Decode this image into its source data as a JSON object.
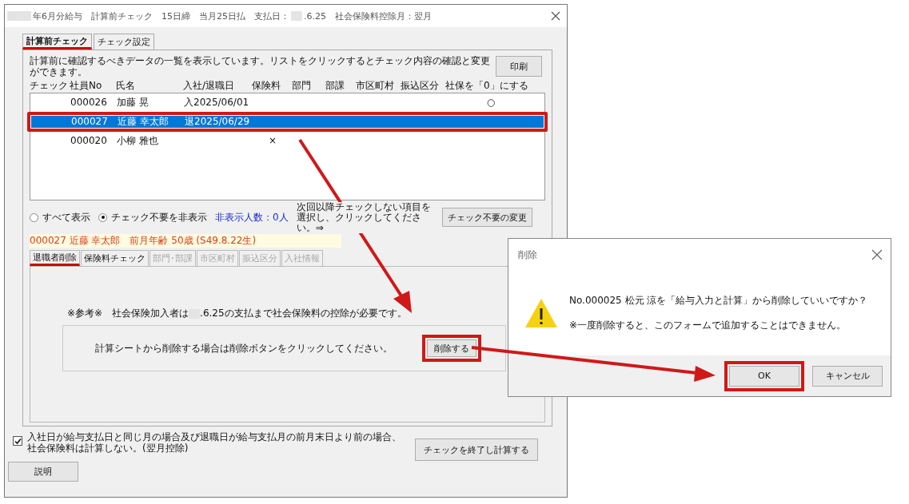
{
  "window": {
    "title_before": "年6月分給与　計算前チェック　15日締　当月25日払　支払日：",
    "title_after": ".6.25　社会保険料控除月：翌月"
  },
  "tabs": [
    {
      "label": "計算前チェック",
      "selected": true
    },
    {
      "label": "チェック設定",
      "selected": false
    }
  ],
  "instruction": "計算前に確認するべきデータの一覧を表示しています。リストをクリックするとチェック内容の確認と変更ができます。",
  "print_button": "印刷",
  "columns": [
    "チェック",
    "社員No",
    "氏名",
    "入社/退職日",
    "保険料",
    "部門",
    "部課",
    "市区町村",
    "振込区分",
    "社保を「0」にする"
  ],
  "rows": [
    {
      "no": "000026",
      "name": "加藤 晃",
      "date": "入2025/06/01",
      "zero": "○",
      "selected": false
    },
    {
      "no": "000027",
      "name": "近藤 幸太郎",
      "date": "退2025/06/29",
      "selected": true
    },
    {
      "no": "000020",
      "name": "小柳 雅也",
      "insurance": "×",
      "selected": false
    }
  ],
  "filter_options": [
    {
      "label": "すべて表示",
      "selected": false
    },
    {
      "label": "チェック不要を非表示",
      "selected": true
    }
  ],
  "hidden_count": "非表示人数：0人",
  "hint": "次回以降チェックしない項目を選択し、クリックしてください。⇒",
  "change_button": "チェック不要の変更",
  "employee_info": "000027 近藤 幸太郎　前月年齢 50歳 (S49.8.22生)",
  "sub_tabs": [
    {
      "label": "退職者削除",
      "selected": true,
      "disabled": false
    },
    {
      "label": "保険料チェック",
      "selected": false,
      "disabled": false
    },
    {
      "label": "部門･部課",
      "selected": false,
      "disabled": true
    },
    {
      "label": "市区町村",
      "selected": false,
      "disabled": true
    },
    {
      "label": "振込区分",
      "selected": false,
      "disabled": true
    },
    {
      "label": "入社情報",
      "selected": false,
      "disabled": true
    }
  ],
  "note_before": "※参考※　社会保険加入者は",
  "note_after": ".6.25の支払まで社会保険料の控除が必要です。",
  "delete_instruction": "計算シートから削除する場合は削除ボタンをクリックしてください。",
  "delete_button": "削除する",
  "exclude_option": {
    "lines": [
      "入社日が給与支払日と同じ月の場合及び退職日が給与支払月の前月末日より前の場合、",
      "社会保険料は計算しない。(翌月控除)"
    ],
    "checked": true
  },
  "finish_button": "チェックを終了し計算する",
  "help_button": "説明",
  "dialog": {
    "title": "削除",
    "message": "No.000025 松元 涼を「給与入力と計算」から削除していいですか？",
    "note": "※一度削除すると、このフォームで追加することはできません。",
    "buttons": [
      "OK",
      "キャンセル"
    ]
  }
}
